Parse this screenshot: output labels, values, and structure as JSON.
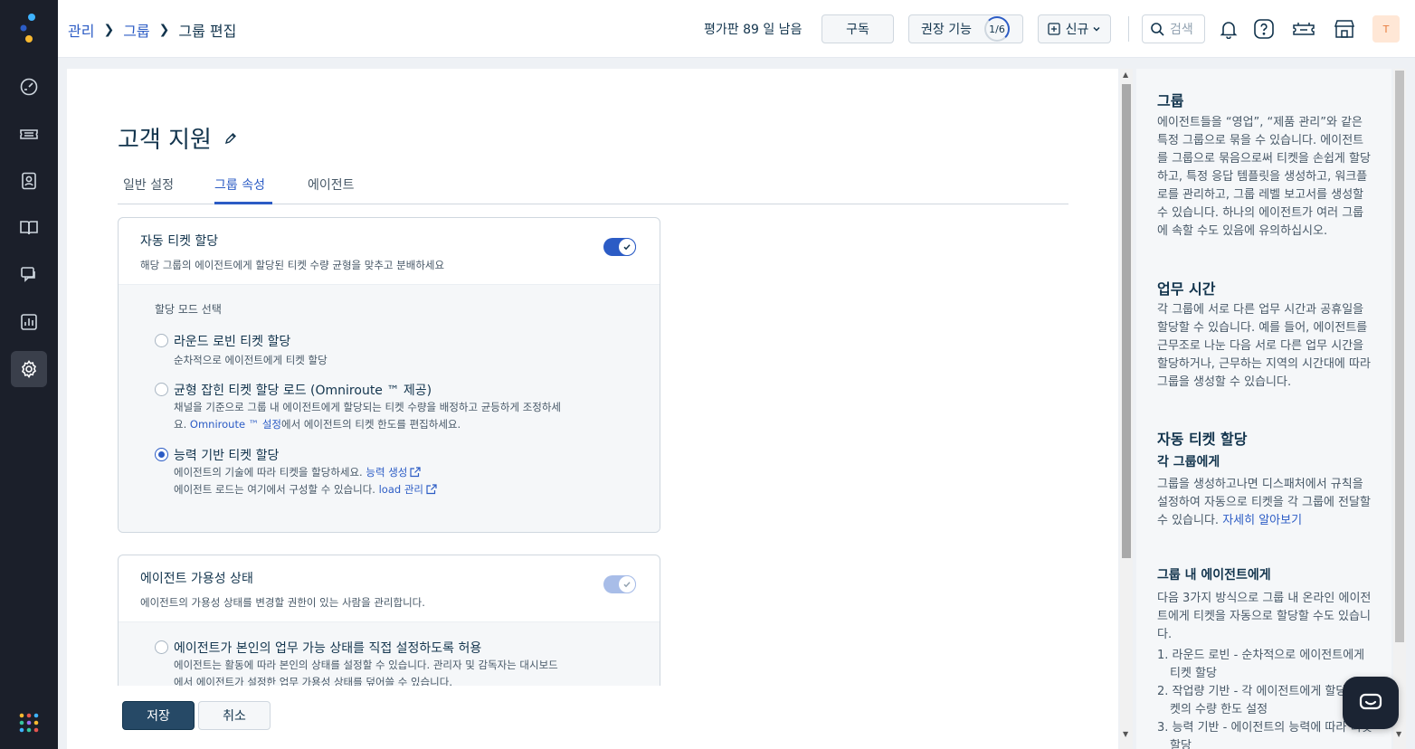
{
  "topbar": {
    "breadcrumb": [
      "관리",
      "그룹",
      "그룹 편집"
    ],
    "trial": "평가판 89 일 남음",
    "subscribe": "구독",
    "recommend": "권장 기능",
    "recommend_progress": "1/6",
    "new": "신규",
    "search_placeholder": "검색",
    "avatar": "T"
  },
  "nav": {
    "icons": [
      "dashboard-icon",
      "tickets-icon",
      "contacts-icon",
      "solutions-icon",
      "forums-icon",
      "reports-icon",
      "admin-icon"
    ],
    "active": "admin-icon"
  },
  "main": {
    "title": "고객 지원",
    "tabs": [
      "일반 설정",
      "그룹 속성",
      "에이전트"
    ],
    "active_tab": "그룹 속성",
    "auto_assign": {
      "title": "자동 티켓 할당",
      "desc": "해당 그룹의 에이전트에게 할당된 티켓 수량 균형을 맞추고 분배하세요",
      "enabled": true,
      "mode_label": "할당 모드 선택",
      "options": [
        {
          "title": "라운드 로빈 티켓 할당",
          "desc": "순차적으로 에이전트에게 티켓 할당",
          "checked": false
        },
        {
          "title": "균형 잡힌 티켓 할당 로드 (Omniroute ™ 제공)",
          "desc_1": "채널을 기준으로 그룹 내 에이전트에게 할당되는 티켓 수량을 배정하고 균등하게 조정하세",
          "desc_2_pre": "요. ",
          "desc_2_link": "Omniroute ™ 설정",
          "desc_2_post": "에서 에이전트의 티켓 한도를 편집하세요.",
          "checked": false
        },
        {
          "title": "능력 기반 티켓 할당",
          "desc_1_pre": "에이전트의 기술에 따라 티켓을 할당하세요. ",
          "desc_1_link": "능력 생성",
          "desc_2_pre": "에이전트 로드는 여기에서 구성할 수 있습니다. ",
          "desc_2_link": "load 관리",
          "checked": true
        }
      ]
    },
    "availability": {
      "title": "에이전트 가용성 상태",
      "desc": "에이전트의 가용성 상태를 변경할 권한이 있는 사람을 관리합니다.",
      "enabled": true,
      "option_title": "에이전트가 본인의 업무 가능 상태를 직접 설정하도록 허용",
      "option_desc_1": "에이전트는 활동에 따라 본인의 상태를 설정할 수 있습니다. 관리자 및 감독자는 대시보드",
      "option_desc_2": "에서 에이전트가 설정한 업무 가용성 상태를 덮어쓸 수 있습니다."
    },
    "save": "저장",
    "cancel": "취소"
  },
  "help": {
    "groups_title": "그룹",
    "groups_text": "에이전트들을 “영업”, “제품 관리”와 같은 특정 그룹으로 묶을 수 있습니다. 에이전트를 그룹으로 묶음으로써 티켓을 손쉽게 할당하고, 특정 응답 템플릿을 생성하고, 워크플로를 관리하고, 그룹 레벨 보고서를 생성할 수 있습니다. 하나의 에이전트가 여러 그룹에 속할 수도 있음에 유의하십시오.",
    "hours_title": "업무 시간",
    "hours_text": "각 그룹에 서로 다른 업무 시간과 공휴일을 할당할 수 있습니다. 예를 들어, 에이전트를 근무조로 나눈 다음 서로 다른 업무 시간을 할당하거나, 근무하는 지역의 시간대에 따라 그룹을 생성할 수 있습니다.",
    "auto_title": "자동 티켓 할당",
    "to_group_title": "각 그룹에게",
    "to_group_text": "그룹을 생성하고나면 디스패처에서 규칙을 설정하여 자동으로 티켓을 각 그룹에 전달할 수 있습니다. ",
    "learn_more": "자세히 알아보기",
    "to_agents_title": "그룹 내 에이전트에게",
    "to_agents_text": "다음 3가지 방식으로 그룹 내 온라인 에이전트에게 티켓을 자동으로 할당할 수도 있습니다.",
    "list": [
      "1. 라운드 로빈 - 순차적으로 에이전트에게 티켓 할당",
      "2. 작업량 기반 - 각 에이전트에게 할당된 티켓의 수량 한도 설정",
      "3. 능력 기반 - 에이전트의 능력에 따라 티켓 할당"
    ]
  },
  "colors": {
    "accent": "#2c5cc5",
    "nav_bg": "#1b1f2a",
    "primary_button": "#264966"
  }
}
